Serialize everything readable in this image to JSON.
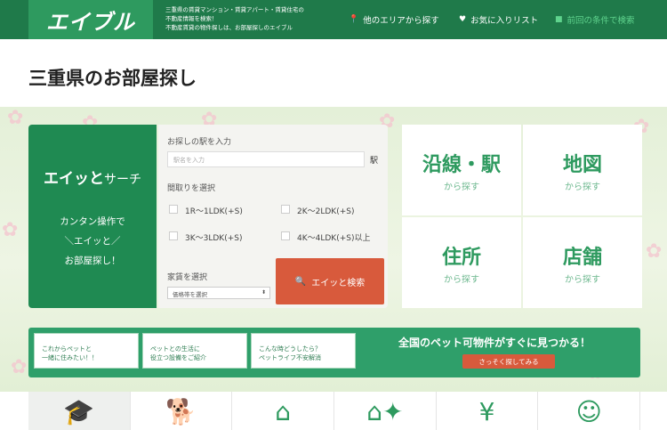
{
  "header": {
    "logo_text": "エイブル",
    "tagline": [
      "三重県の賃貸マンション・賃貸アパート・賃貸住宅の",
      "不動産情報を検索！",
      "不動産賃貸の物件探しは、お部屋探しのエイブル"
    ],
    "nav": [
      {
        "label": "他のエリアから探す",
        "icon": "pin-icon"
      },
      {
        "label": "お気に入りリスト",
        "icon": "heart-icon"
      },
      {
        "label": "前回の条件で検索",
        "icon": "square-icon"
      }
    ]
  },
  "page_title": "三重県のお部屋探し",
  "search": {
    "brand_main": "エイッと",
    "brand_suffix": "サーチ",
    "catch": [
      "カンタン操作で",
      "＼エイッと／",
      "お部屋探し！"
    ],
    "station_label": "お探しの駅を入力",
    "station_placeholder": "駅名を入力",
    "station_suffix": "駅",
    "layout_label": "間取りを選択",
    "layouts": [
      "1R～1LDK(+S)",
      "2K～2LDK(+S)",
      "3K～3LDK(+S)",
      "4K～4LDK(+S)以上"
    ],
    "rent_label": "家賃を選択",
    "rent_select": "価格帯を選択",
    "button": "エイッと検索"
  },
  "tiles": [
    {
      "big": "沿線・駅",
      "small": "から探す"
    },
    {
      "big": "地図",
      "small": "から探す"
    },
    {
      "big": "住所",
      "small": "から探す"
    },
    {
      "big": "店舗",
      "small": "から探す"
    }
  ],
  "pet": {
    "cards": [
      [
        "これからペットと",
        "一緒に住みたい！！"
      ],
      [
        "ペットとの生活に",
        "役立つ設備をご紹介"
      ],
      [
        "こんな時どうしたら？",
        "ペットライフ不安解消"
      ]
    ],
    "headline": "全国のペット可物件がすぐに見つかる！",
    "button": "さっそく探してみる"
  },
  "bottom_icons": [
    "graduation-cap-icon",
    "dog-icon",
    "house-icon",
    "sparkle-house-icon",
    "yen-icon",
    "person-icon"
  ]
}
